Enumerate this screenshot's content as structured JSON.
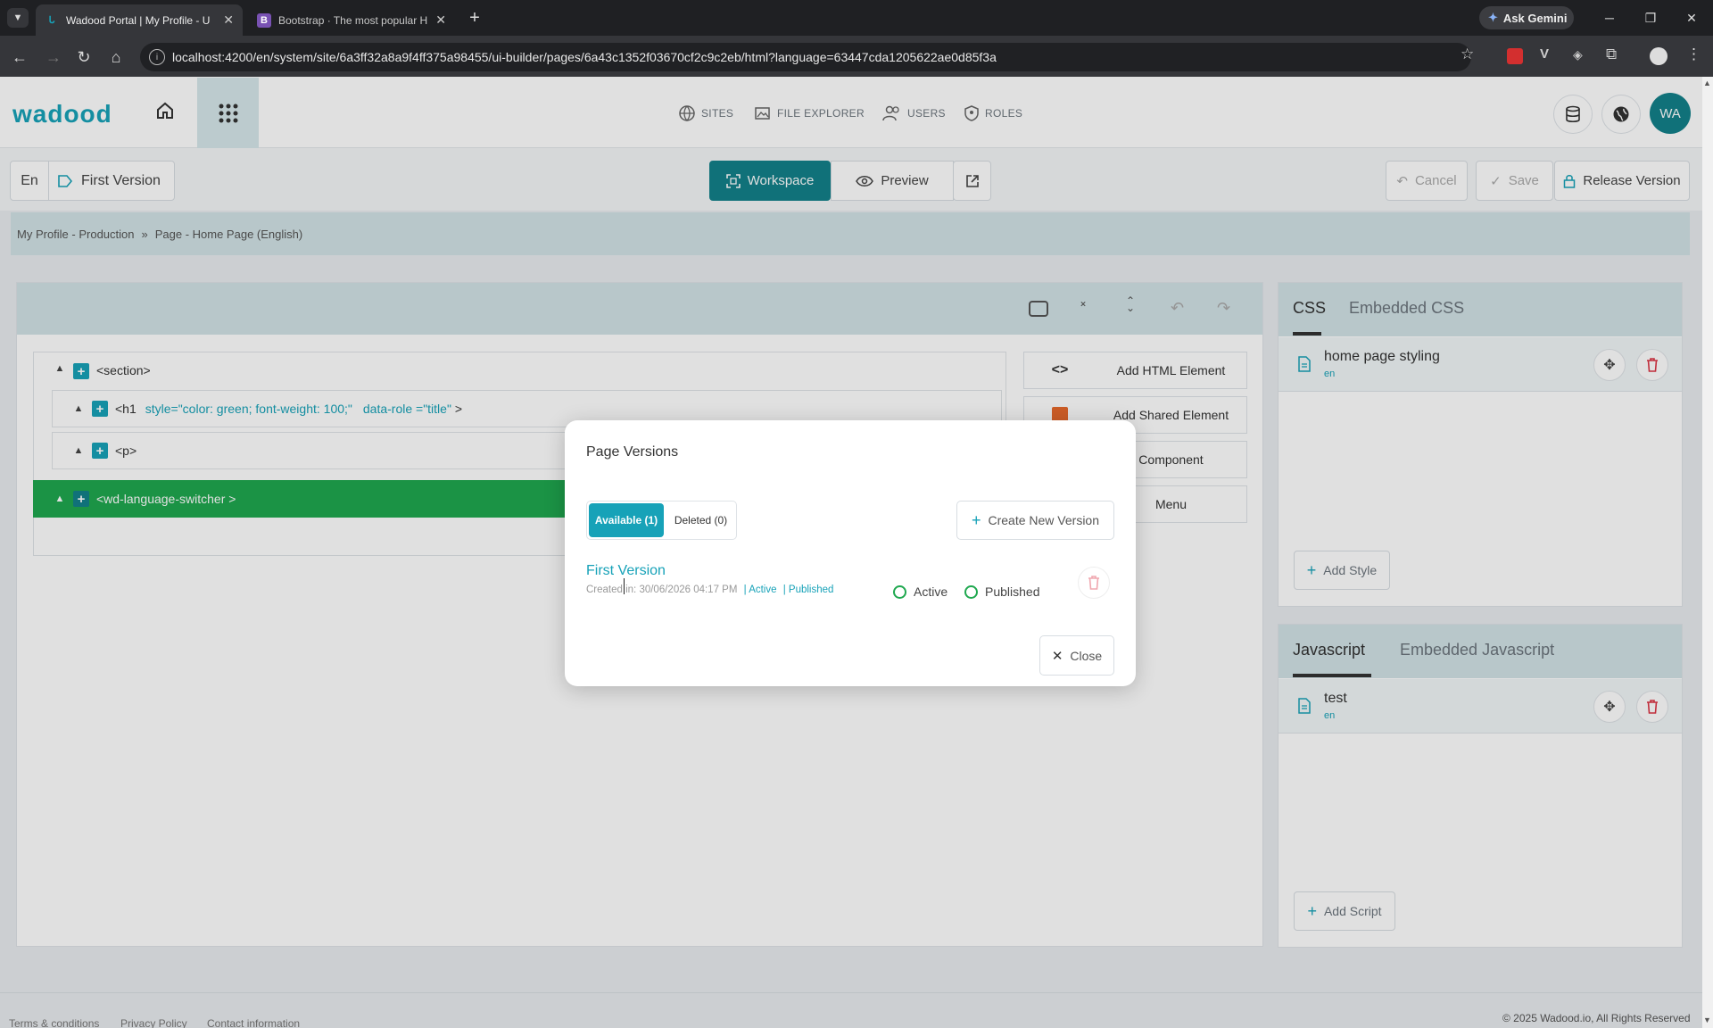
{
  "browser": {
    "tabs": [
      {
        "title": "Wadood Portal | My Profile - U",
        "active": true
      },
      {
        "title": "Bootstrap · The most popular H",
        "active": false
      }
    ],
    "url": "localhost:4200/en/system/site/6a3ff32a8a9f4ff375a98455/ui-builder/pages/6a43c1352f03670cf2c9c2eb/html?language=63447cda1205622ae0d85f3a",
    "gemini_label": "Ask Gemini"
  },
  "header": {
    "logo": "wadood",
    "nav": [
      {
        "label": "SITES",
        "icon": "globe-icon"
      },
      {
        "label": "FILE EXPLORER",
        "icon": "image-folder-icon"
      },
      {
        "label": "USERS",
        "icon": "users-icon"
      },
      {
        "label": "ROLES",
        "icon": "shield-icon"
      }
    ],
    "avatar": "WA"
  },
  "toolbar": {
    "lang": "En",
    "version": "First Version",
    "workspace": "Workspace",
    "preview": "Preview",
    "cancel": "Cancel",
    "save": "Save",
    "release": "Release Version"
  },
  "breadcrumb": {
    "first": "My Profile - Production",
    "sep": "»",
    "second": "Page - Home Page (English)"
  },
  "tree": {
    "section": "<section>",
    "h1_tag": "<h1",
    "h1_attr1": "style=\"color: green; font-weight: 100;\"",
    "h1_attr2": "data-role =\"title\"",
    "h1_close": ">",
    "p": "<p>",
    "lang_switcher": "<wd-language-switcher >"
  },
  "side_actions": {
    "html": "Add HTML Element",
    "shared": "Add Shared Element",
    "component": "Component",
    "menu": "Menu"
  },
  "css_panel": {
    "tab1": "CSS",
    "tab2": "Embedded CSS",
    "item_name": "home page styling",
    "item_lang": "en",
    "add": "Add Style"
  },
  "js_panel": {
    "tab1": "Javascript",
    "tab2": "Embedded Javascript",
    "item_name": "test",
    "item_lang": "en",
    "add": "Add Script"
  },
  "modal": {
    "title": "Page Versions",
    "tab_available": "Available (1)",
    "tab_deleted": "Deleted (0)",
    "create": "Create New Version",
    "version_name": "First Version",
    "created": "Created in: 30/06/2026 04:17 PM",
    "meta_active": "| Active",
    "meta_published": "| Published",
    "radio_active": "Active",
    "radio_published": "Published",
    "close": "Close"
  },
  "footer": {
    "terms": "Terms & conditions",
    "privacy": "Privacy Policy",
    "contact": "Contact information",
    "copyright": "© 2025 Wadood.io, All Rights Reserved"
  },
  "colors": {
    "brand": "#17a2b8",
    "workspace_active": "#13818a",
    "lang_switcher_row": "#1fa84f",
    "danger": "#dc3545"
  }
}
